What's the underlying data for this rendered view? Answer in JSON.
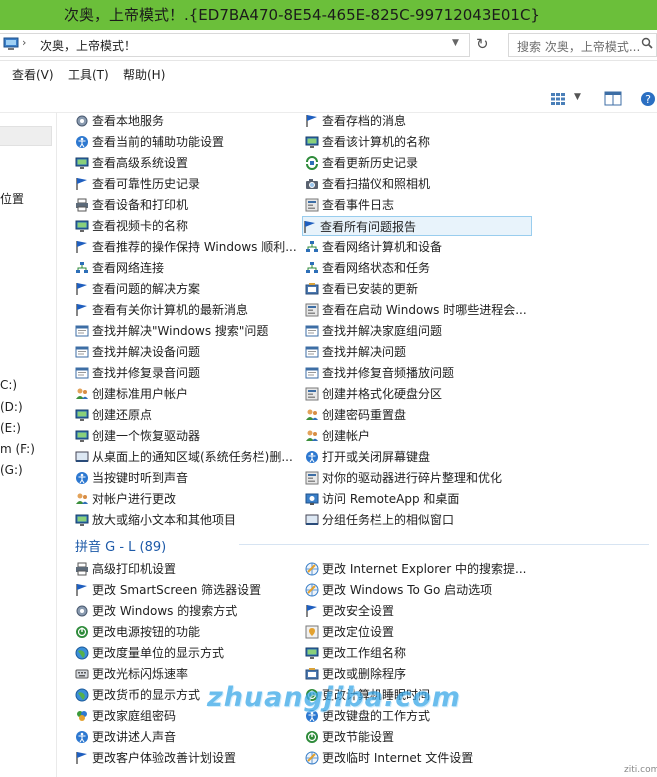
{
  "window": {
    "title": "次奥，上帝模式！.{ED7BA470-8E54-465E-825C-99712043E01C}",
    "accent": "#6bbf3a"
  },
  "address": {
    "path": "次奥，上帝模式！",
    "search_placeholder": "搜索 次奥，上帝模式..."
  },
  "menu": [
    "查看(V)",
    "工具(T)",
    "帮助(H)"
  ],
  "sidebar": {
    "items": [
      "位置",
      "C:)",
      "(D:)",
      "(E:)",
      "m (F:)",
      "(G:)"
    ]
  },
  "group_g_l": {
    "header": "拼音 G - L (89)"
  },
  "left_column": [
    {
      "label": "查看本地服务",
      "icon": "gear-icon"
    },
    {
      "label": "查看当前的辅助功能设置",
      "icon": "ease-of-access-icon"
    },
    {
      "label": "查看高级系统设置",
      "icon": "monitor-icon"
    },
    {
      "label": "查看可靠性历史记录",
      "icon": "flag-icon"
    },
    {
      "label": "查看设备和打印机",
      "icon": "printer-icon"
    },
    {
      "label": "查看视频卡的名称",
      "icon": "monitor-icon"
    },
    {
      "label": "查看推荐的操作保持 Windows 顺利...",
      "icon": "flag-icon"
    },
    {
      "label": "查看网络连接",
      "icon": "network-icon"
    },
    {
      "label": "查看问题的解决方案",
      "icon": "flag-icon"
    },
    {
      "label": "查看有关你计算机的最新消息",
      "icon": "flag-icon"
    },
    {
      "label": "查找并解决\"Windows 搜索\"问题",
      "icon": "troubleshoot-icon"
    },
    {
      "label": "查找并解决设备问题",
      "icon": "troubleshoot-icon"
    },
    {
      "label": "查找并修复录音问题",
      "icon": "troubleshoot-icon"
    },
    {
      "label": "创建标准用户帐户",
      "icon": "users-icon"
    },
    {
      "label": "创建还原点",
      "icon": "monitor-icon"
    },
    {
      "label": "创建一个恢复驱动器",
      "icon": "monitor-icon"
    },
    {
      "label": "从桌面上的通知区域(系统任务栏)删...",
      "icon": "taskbar-icon"
    },
    {
      "label": "当按键时听到声音",
      "icon": "ease-of-access-icon"
    },
    {
      "label": "对帐户进行更改",
      "icon": "users-icon"
    },
    {
      "label": "放大或缩小文本和其他项目",
      "icon": "monitor-icon"
    },
    {
      "label": "高级打印机设置",
      "icon": "printer-icon"
    },
    {
      "label": "更改 SmartScreen 筛选器设置",
      "icon": "flag-icon"
    },
    {
      "label": "更改 Windows 的搜索方式",
      "icon": "gear-icon"
    },
    {
      "label": "更改电源按钮的功能",
      "icon": "power-icon"
    },
    {
      "label": "更改度量单位的显示方式",
      "icon": "globe-icon"
    },
    {
      "label": "更改光标闪烁速率",
      "icon": "keyboard-icon"
    },
    {
      "label": "更改货币的显示方式",
      "icon": "globe-icon"
    },
    {
      "label": "更改家庭组密码",
      "icon": "homegroup-icon"
    },
    {
      "label": "更改讲述人声音",
      "icon": "ease-of-access-icon"
    },
    {
      "label": "更改客户体验改善计划设置",
      "icon": "flag-icon"
    }
  ],
  "right_column": [
    {
      "label": "查看存档的消息",
      "icon": "flag-icon"
    },
    {
      "label": "查看该计算机的名称",
      "icon": "monitor-icon"
    },
    {
      "label": "查看更新历史记录",
      "icon": "update-icon"
    },
    {
      "label": "查看扫描仪和照相机",
      "icon": "camera-icon"
    },
    {
      "label": "查看事件日志",
      "icon": "admin-icon"
    },
    {
      "label": "查看所有问题报告",
      "icon": "flag-icon",
      "highlight": true
    },
    {
      "label": "查看网络计算机和设备",
      "icon": "network-icon"
    },
    {
      "label": "查看网络状态和任务",
      "icon": "network-icon"
    },
    {
      "label": "查看已安装的更新",
      "icon": "programs-icon"
    },
    {
      "label": "查看在启动 Windows 时哪些进程会...",
      "icon": "admin-icon"
    },
    {
      "label": "查找并解决家庭组问题",
      "icon": "troubleshoot-icon"
    },
    {
      "label": "查找并解决问题",
      "icon": "troubleshoot-icon"
    },
    {
      "label": "查找并修复音频播放问题",
      "icon": "troubleshoot-icon"
    },
    {
      "label": "创建并格式化硬盘分区",
      "icon": "admin-icon"
    },
    {
      "label": "创建密码重置盘",
      "icon": "users-icon"
    },
    {
      "label": "创建帐户",
      "icon": "users-icon"
    },
    {
      "label": "打开或关闭屏幕键盘",
      "icon": "ease-of-access-icon"
    },
    {
      "label": "对你的驱动器进行碎片整理和优化",
      "icon": "admin-icon"
    },
    {
      "label": "访问 RemoteApp 和桌面",
      "icon": "remote-icon"
    },
    {
      "label": "分组任务栏上的相似窗口",
      "icon": "taskbar-icon"
    },
    {
      "label": "更改 Internet Explorer 中的搜索提...",
      "icon": "internet-icon"
    },
    {
      "label": "更改 Windows To Go 启动选项",
      "icon": "internet-icon"
    },
    {
      "label": "更改安全设置",
      "icon": "flag-icon"
    },
    {
      "label": "更改定位设置",
      "icon": "location-icon"
    },
    {
      "label": "更改工作组名称",
      "icon": "monitor-icon"
    },
    {
      "label": "更改或删除程序",
      "icon": "programs-icon"
    },
    {
      "label": "更改计算机睡眠时间",
      "icon": "power-icon"
    },
    {
      "label": "更改键盘的工作方式",
      "icon": "ease-of-access-icon"
    },
    {
      "label": "更改节能设置",
      "icon": "power-icon"
    },
    {
      "label": "更改临时 Internet 文件设置",
      "icon": "internet-icon"
    }
  ],
  "watermark": "zhuangjiba.com",
  "watermark_corner": "ziti.com"
}
